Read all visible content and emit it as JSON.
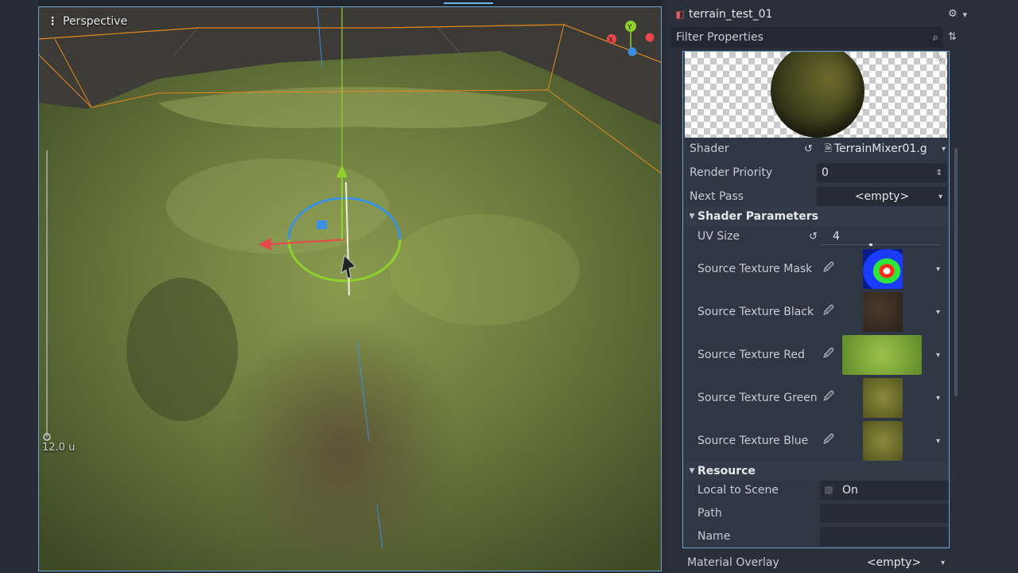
{
  "viewport": {
    "view_label": "Perspective",
    "menu_icon": "vertical-dots-icon",
    "scale_label": "12.0 u",
    "gizmo_axes": [
      "X",
      "Y",
      "Z"
    ]
  },
  "inspector": {
    "resource_name": "terrain_test_01",
    "filter_placeholder": "Filter Properties",
    "properties": {
      "shader": {
        "label": "Shader",
        "value": "TerrainMixer01.g"
      },
      "render_priority": {
        "label": "Render Priority",
        "value": "0"
      },
      "next_pass": {
        "label": "Next Pass",
        "value": "<empty>"
      }
    },
    "shader_parameters": {
      "title": "Shader Parameters",
      "uv_size": {
        "label": "UV Size",
        "value": "4"
      },
      "textures": [
        {
          "label": "Source Texture Mask",
          "thumb": "mask"
        },
        {
          "label": "Source Texture Black",
          "thumb": "black"
        },
        {
          "label": "Source Texture Red",
          "thumb": "red"
        },
        {
          "label": "Source Texture Green",
          "thumb": "green"
        },
        {
          "label": "Source Texture Blue",
          "thumb": "blue"
        }
      ]
    },
    "resource": {
      "title": "Resource",
      "local_to_scene": {
        "label": "Local to Scene",
        "value": "On"
      },
      "path": {
        "label": "Path",
        "value": ""
      },
      "name": {
        "label": "Name",
        "value": ""
      }
    },
    "material_overlay": {
      "label": "Material Overlay",
      "value": "<empty>"
    }
  },
  "colors": {
    "accent": "#6fa1c9",
    "axis_x": "#e8474b",
    "axis_y": "#8fd12c",
    "axis_z": "#3b8fe0"
  }
}
